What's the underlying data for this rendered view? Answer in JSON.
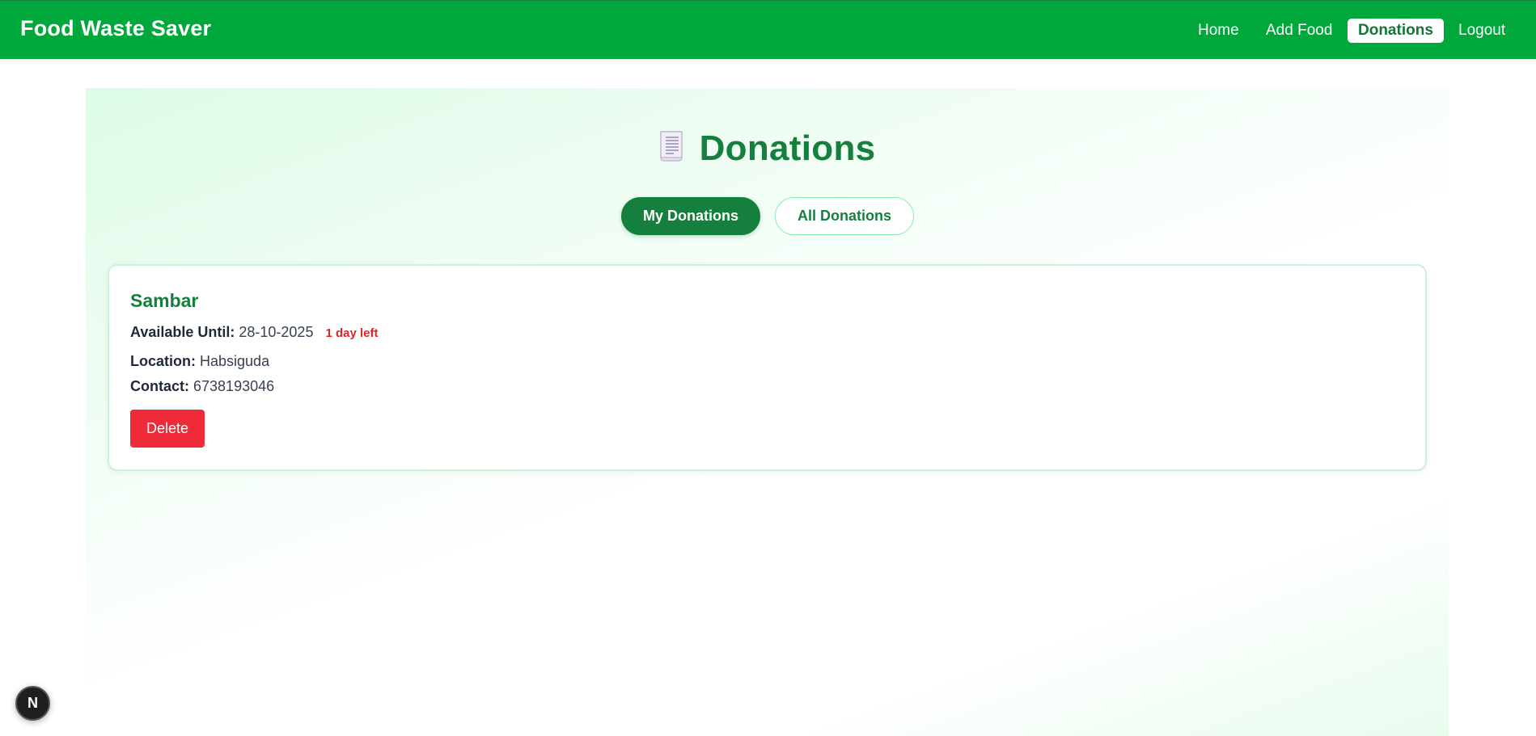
{
  "navbar": {
    "brand": "Food Waste Saver",
    "links": [
      {
        "label": "Home",
        "active": false
      },
      {
        "label": "Add Food",
        "active": false
      },
      {
        "label": "Donations",
        "active": true
      },
      {
        "label": "Logout",
        "active": false
      }
    ],
    "color": "#00a83c"
  },
  "page": {
    "title_icon": "receipt-icon",
    "title": "Donations",
    "tabs": [
      {
        "label": "My Donations",
        "active": true
      },
      {
        "label": "All Donations",
        "active": false
      }
    ]
  },
  "donations": [
    {
      "name": "Sambar",
      "available_label": "Available Until:",
      "available_until": "28-10-2025",
      "days_left": "1 day left",
      "location_label": "Location:",
      "location": "Habsiguda",
      "contact_label": "Contact:",
      "contact": "6738193046",
      "delete_label": "Delete"
    }
  ],
  "dev_badge": {
    "label": "N",
    "icon": "nextjs-icon"
  },
  "colors": {
    "primary": "#15803d",
    "danger": "#ef2b3a",
    "warning_text": "#dc2626"
  }
}
